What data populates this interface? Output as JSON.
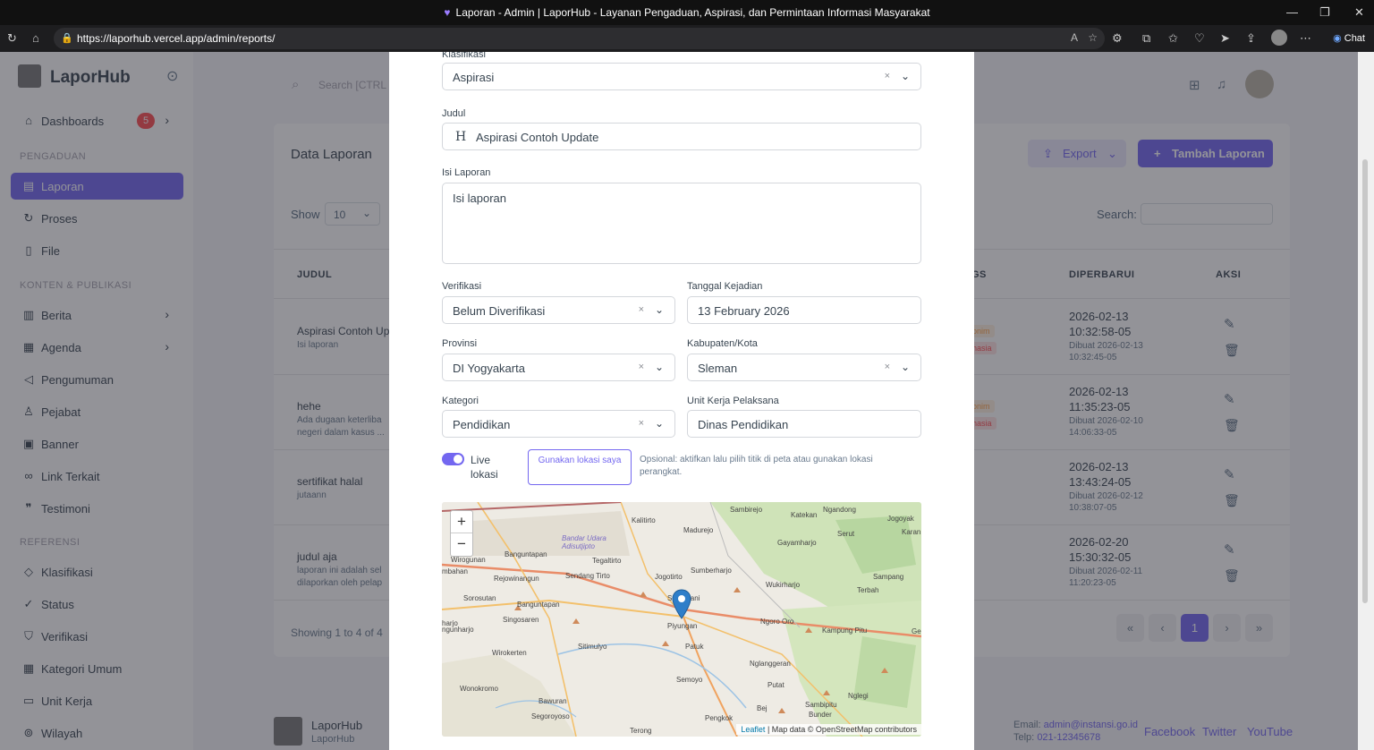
{
  "browser": {
    "tab_title": "Laporan - Admin | LaporHub - Layanan Pengaduan, Aspirasi, dan Permintaan Informasi Masyarakat",
    "url": "https://laporhub.vercel.app/admin/reports/",
    "chat_label": "Chat"
  },
  "sidebar": {
    "brand": "LaporHub",
    "dashboards": "Dashboards",
    "dashboards_badge": "5",
    "section_pengaduan": "PENGADUAN",
    "section_konten": "KONTEN & PUBLIKASI",
    "section_referensi": "REFERENSI",
    "items": [
      {
        "label": "Laporan"
      },
      {
        "label": "Proses"
      },
      {
        "label": "File"
      },
      {
        "label": "Berita"
      },
      {
        "label": "Agenda"
      },
      {
        "label": "Pengumuman"
      },
      {
        "label": "Pejabat"
      },
      {
        "label": "Banner"
      },
      {
        "label": "Link Terkait"
      },
      {
        "label": "Testimoni"
      },
      {
        "label": "Klasifikasi"
      },
      {
        "label": "Status"
      },
      {
        "label": "Verifikasi"
      },
      {
        "label": "Kategori Umum"
      },
      {
        "label": "Unit Kerja"
      },
      {
        "label": "Wilayah"
      }
    ]
  },
  "topbar": {
    "search_placeholder": "Search [CTRL"
  },
  "page": {
    "title": "Data Laporan",
    "export_label": "Export",
    "add_label": "Tambah Laporan",
    "show_label": "Show",
    "show_value": "10",
    "search_label": "Search:",
    "columns": {
      "judul": "JUDUL",
      "tags": "GS",
      "diperbarui": "DIPERBARUI",
      "aksi": "AKSI"
    },
    "rows": [
      {
        "title": "Aspirasi Contoh Up",
        "desc": "Isi laporan",
        "tag1": "onim",
        "tag2": "hasia",
        "updated": "2026-02-13 10:32:58-05",
        "created": "Dibuat 2026-02-13 10:32:45-05"
      },
      {
        "title": "hehe",
        "desc": "Ada dugaan keterliba negeri dalam kasus ...",
        "tag1": "onim",
        "tag2": "hasia",
        "updated": "2026-02-13 11:35:23-05",
        "created": "Dibuat 2026-02-10 14:06:33-05"
      },
      {
        "title": "sertifikat halal",
        "desc": "jutaann",
        "tag1": "",
        "tag2": "",
        "updated": "2026-02-13 13:43:24-05",
        "created": "Dibuat 2026-02-12 10:38:07-05"
      },
      {
        "title": "judul aja",
        "desc": "laporan ini adalah sel dilaporkan oleh pelap",
        "tag1": "",
        "tag2": "",
        "updated": "2026-02-20 15:30:32-05",
        "created": "Dibuat 2026-02-11 11:20:23-05"
      }
    ],
    "showing": "Showing 1 to 4 of 4",
    "current_page": "1"
  },
  "footer": {
    "name": "LaporHub",
    "sub": "LaporHub",
    "email_label": "Email:",
    "email": "admin@instansi.go.id",
    "phone_label": "Telp:",
    "phone": "021-12345678",
    "links": [
      "Facebook",
      "Twitter",
      "YouTube"
    ]
  },
  "modal": {
    "klasifikasi_label": "Klasifikasi",
    "klasifikasi": "Aspirasi",
    "judul_label": "Judul",
    "judul": "Aspirasi Contoh Update",
    "isi_label": "Isi Laporan",
    "isi": "Isi laporan",
    "verifikasi_label": "Verifikasi",
    "verifikasi": "Belum Diverifikasi",
    "tanggal_label": "Tanggal Kejadian",
    "tanggal": "13 February 2026",
    "provinsi_label": "Provinsi",
    "provinsi": "DI Yogyakarta",
    "kabupaten_label": "Kabupaten/Kota",
    "kabupaten": "Sleman",
    "kategori_label": "Kategori",
    "kategori": "Pendidikan",
    "unit_label": "Unit Kerja Pelaksana",
    "unit": "Dinas Pendidikan",
    "live_label": "Live lokasi",
    "live_on": true,
    "lokasi_button": "Gunakan lokasi saya",
    "hint": "Opsional: aktifkan lalu pilih titik di peta atau gunakan lokasi perangkat.",
    "map": {
      "zoom_in": "+",
      "zoom_out": "−",
      "attribution_link": "Leaflet",
      "attribution": "| Map data © OpenStreetMap contributors",
      "places": [
        "Sambirejo",
        "Katekan",
        "Ngandong",
        "Jogoyak",
        "Kalitirto",
        "Madurejo",
        "Serut",
        "Karan",
        "Bandar Udara Adisutjipto",
        "Banguntapan",
        "Wirogunan",
        "Tegaltirto",
        "Gayamharjo",
        "Rejowinangun",
        "Sendang Tirto",
        "Jogotirto",
        "Sumberharjo",
        "Wukirharjo",
        "Sampang",
        "Terbah",
        "Sorosutan",
        "Srimartani",
        "Banguntapan",
        "Singosaren",
        "Piyungan",
        "Ngoro Oro",
        "Kampung Pitu",
        "Sitimulyo",
        "Patuk",
        "Wirokerten",
        "Nglanggeran",
        "Semoyo",
        "Wonokromo",
        "Putat",
        "Nglegi",
        "Bawuran",
        "Segoroyoso",
        "Sambipitu",
        "Bunder",
        "Pengkok",
        "Bej",
        "Terong",
        "mbahan",
        "ngunharjo",
        "harjo",
        "Ge"
      ]
    }
  }
}
